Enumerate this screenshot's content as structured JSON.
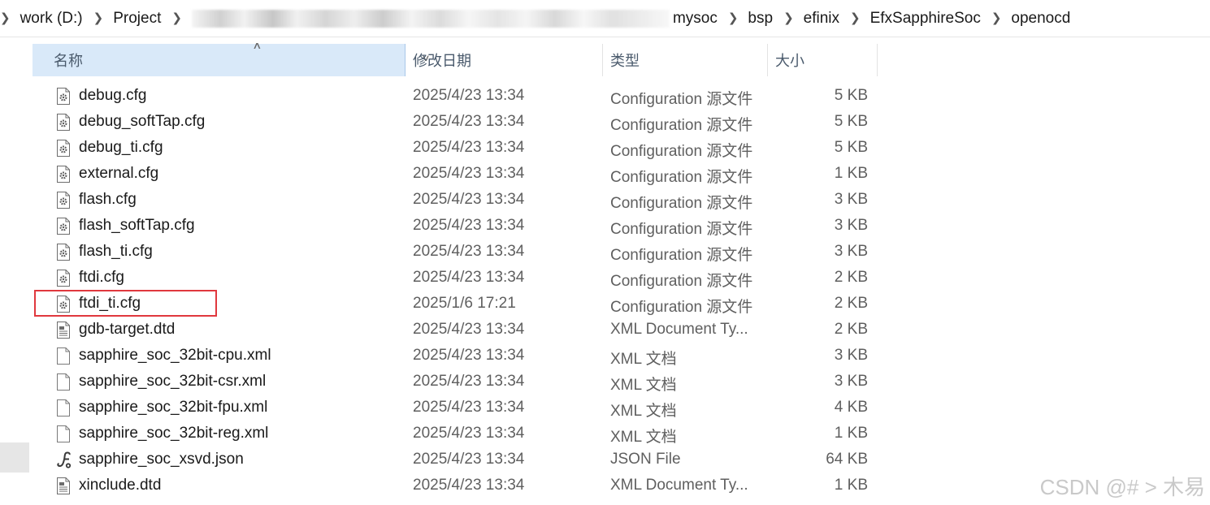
{
  "breadcrumb": [
    "work (D:)",
    "Project",
    "mysoc",
    "bsp",
    "efinix",
    "EfxSapphireSoc",
    "openocd"
  ],
  "columns": {
    "name": "名称",
    "date": "修改日期",
    "type": "类型",
    "size": "大小"
  },
  "files": [
    {
      "name": "debug.cfg",
      "date": "2025/4/23 13:34",
      "type": "Configuration 源文件",
      "size": "5 KB",
      "icon": "config-file-icon"
    },
    {
      "name": "debug_softTap.cfg",
      "date": "2025/4/23 13:34",
      "type": "Configuration 源文件",
      "size": "5 KB",
      "icon": "config-file-icon"
    },
    {
      "name": "debug_ti.cfg",
      "date": "2025/4/23 13:34",
      "type": "Configuration 源文件",
      "size": "5 KB",
      "icon": "config-file-icon"
    },
    {
      "name": "external.cfg",
      "date": "2025/4/23 13:34",
      "type": "Configuration 源文件",
      "size": "1 KB",
      "icon": "config-file-icon"
    },
    {
      "name": "flash.cfg",
      "date": "2025/4/23 13:34",
      "type": "Configuration 源文件",
      "size": "3 KB",
      "icon": "config-file-icon"
    },
    {
      "name": "flash_softTap.cfg",
      "date": "2025/4/23 13:34",
      "type": "Configuration 源文件",
      "size": "3 KB",
      "icon": "config-file-icon"
    },
    {
      "name": "flash_ti.cfg",
      "date": "2025/4/23 13:34",
      "type": "Configuration 源文件",
      "size": "3 KB",
      "icon": "config-file-icon"
    },
    {
      "name": "ftdi.cfg",
      "date": "2025/4/23 13:34",
      "type": "Configuration 源文件",
      "size": "2 KB",
      "icon": "config-file-icon"
    },
    {
      "name": "ftdi_ti.cfg",
      "date": "2025/1/6 17:21",
      "type": "Configuration 源文件",
      "size": "2 KB",
      "icon": "config-file-icon"
    },
    {
      "name": "gdb-target.dtd",
      "date": "2025/4/23 13:34",
      "type": "XML Document Ty...",
      "size": "2 KB",
      "icon": "document-file-icon"
    },
    {
      "name": "sapphire_soc_32bit-cpu.xml",
      "date": "2025/4/23 13:34",
      "type": "XML 文档",
      "size": "3 KB",
      "icon": "blank-file-icon"
    },
    {
      "name": "sapphire_soc_32bit-csr.xml",
      "date": "2025/4/23 13:34",
      "type": "XML 文档",
      "size": "3 KB",
      "icon": "blank-file-icon"
    },
    {
      "name": "sapphire_soc_32bit-fpu.xml",
      "date": "2025/4/23 13:34",
      "type": "XML 文档",
      "size": "4 KB",
      "icon": "blank-file-icon"
    },
    {
      "name": "sapphire_soc_32bit-reg.xml",
      "date": "2025/4/23 13:34",
      "type": "XML 文档",
      "size": "1 KB",
      "icon": "blank-file-icon"
    },
    {
      "name": "sapphire_soc_xsvd.json",
      "date": "2025/4/23 13:34",
      "type": "JSON File",
      "size": "64 KB",
      "icon": "json-file-icon"
    },
    {
      "name": "xinclude.dtd",
      "date": "2025/4/23 13:34",
      "type": "XML Document Ty...",
      "size": "1 KB",
      "icon": "document-file-icon"
    }
  ],
  "watermark": "CSDN @# > 木易"
}
